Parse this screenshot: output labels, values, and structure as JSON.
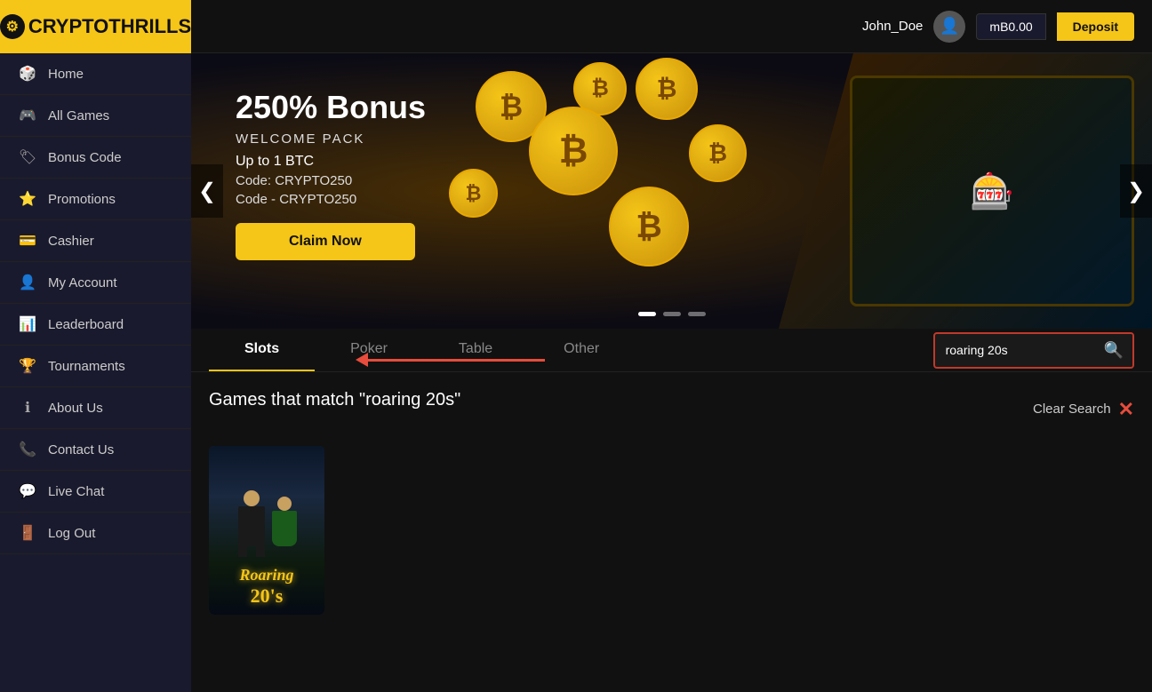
{
  "header": {
    "logo_text": "CRYPTO",
    "logo_text2": "THRILLS",
    "username": "John_Doe",
    "balance": "mB0.00",
    "deposit_label": "Deposit"
  },
  "sidebar": {
    "items": [
      {
        "id": "home",
        "label": "Home",
        "icon": "🎲"
      },
      {
        "id": "all-games",
        "label": "All Games",
        "icon": "🎮"
      },
      {
        "id": "bonus-code",
        "label": "Bonus Code",
        "icon": "🏷"
      },
      {
        "id": "promotions",
        "label": "Promotions",
        "icon": "⭐"
      },
      {
        "id": "cashier",
        "label": "Cashier",
        "icon": "💳"
      },
      {
        "id": "my-account",
        "label": "My Account",
        "icon": "👤"
      },
      {
        "id": "leaderboard",
        "label": "Leaderboard",
        "icon": "📊"
      },
      {
        "id": "tournaments",
        "label": "Tournaments",
        "icon": "🏆"
      },
      {
        "id": "about-us",
        "label": "About Us",
        "icon": "ℹ"
      },
      {
        "id": "contact-us",
        "label": "Contact Us",
        "icon": "📞"
      },
      {
        "id": "live-chat",
        "label": "Live Chat",
        "icon": "💬"
      },
      {
        "id": "log-out",
        "label": "Log Out",
        "icon": "🚪"
      }
    ]
  },
  "banner": {
    "bonus_title": "250% Bonus",
    "welcome_label": "WELCOME PACK",
    "up_to": "Up to 1 BTC",
    "code_line1": "Code: CRYPTO250",
    "code_line2": "Code - CRYPTO250",
    "claim_label": "Claim Now",
    "prev_arrow": "❮",
    "next_arrow": "❯"
  },
  "game_tabs": {
    "tabs": [
      {
        "id": "slots",
        "label": "Slots",
        "active": true
      },
      {
        "id": "poker",
        "label": "Poker",
        "active": false
      },
      {
        "id": "table",
        "label": "Table",
        "active": false
      },
      {
        "id": "other",
        "label": "Other",
        "active": false
      }
    ],
    "search_placeholder": "roaring 20s",
    "search_value": "roaring 20s"
  },
  "search_results": {
    "heading_prefix": "Games that match ",
    "heading_query": "\"roaring 20s\"",
    "clear_label": "Clear Search",
    "games": [
      {
        "id": "roaring-20s",
        "title": "Roaring 20s"
      }
    ]
  }
}
